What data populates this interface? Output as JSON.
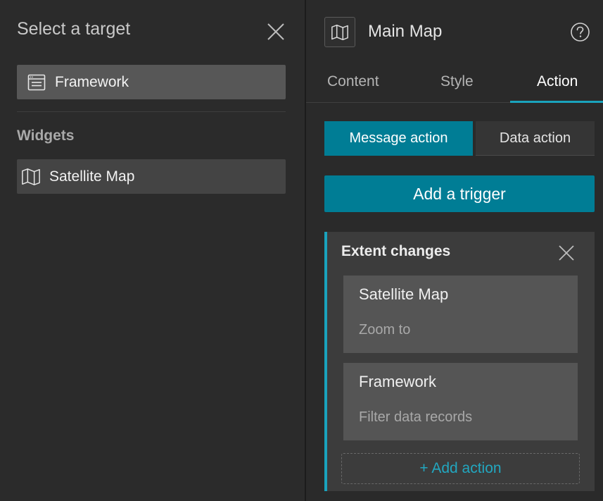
{
  "left_panel": {
    "title": "Select a target",
    "target_item": {
      "label": "Framework",
      "icon": "window-icon"
    },
    "widgets_heading": "Widgets",
    "widget_items": [
      {
        "label": "Satellite Map",
        "icon": "map-icon"
      }
    ]
  },
  "right_panel": {
    "title": "Main Map",
    "tabs": [
      {
        "label": "Content",
        "active": false
      },
      {
        "label": "Style",
        "active": false
      },
      {
        "label": "Action",
        "active": true
      }
    ],
    "segments": {
      "message_action": "Message action",
      "data_action": "Data action",
      "selected": "Message action"
    },
    "add_trigger_label": "Add a trigger",
    "trigger_card": {
      "title": "Extent changes",
      "actions": [
        {
          "target": "Satellite Map",
          "action": "Zoom to"
        },
        {
          "target": "Framework",
          "action": "Filter data records"
        }
      ],
      "add_action_label": "+ Add action"
    }
  },
  "colors": {
    "accent": "#007d95",
    "accent_line": "#1aa3bd",
    "background": "#2a2a2a"
  }
}
